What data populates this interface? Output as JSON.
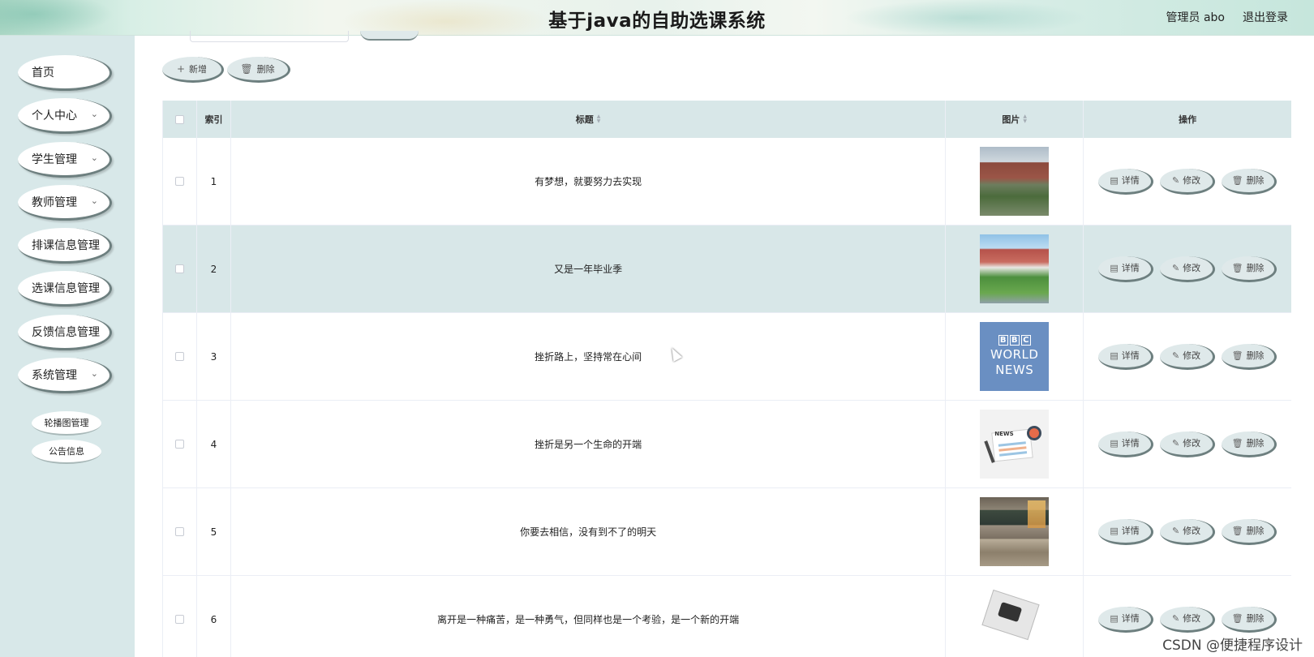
{
  "header": {
    "title": "基于java的自助选课系统",
    "user_label": "管理员 abo",
    "logout_label": "退出登录"
  },
  "sidebar": {
    "items": [
      {
        "label": "首页",
        "has_children": false
      },
      {
        "label": "个人中心",
        "has_children": true
      },
      {
        "label": "学生管理",
        "has_children": true
      },
      {
        "label": "教师管理",
        "has_children": true
      },
      {
        "label": "排课信息管理",
        "has_children": false
      },
      {
        "label": "选课信息管理",
        "has_children": false
      },
      {
        "label": "反馈信息管理",
        "has_children": false
      },
      {
        "label": "系统管理",
        "has_children": true
      }
    ],
    "sub_items": [
      "轮播图管理",
      "公告信息"
    ]
  },
  "toolbar": {
    "add_label": "新增",
    "delete_label": "删除"
  },
  "table": {
    "columns": [
      "索引",
      "标题",
      "图片",
      "操作"
    ],
    "rows": [
      {
        "index": "1",
        "title": "有梦想，就要努力去实现",
        "image": "campus-building"
      },
      {
        "index": "2",
        "title": "又是一年毕业季",
        "image": "campus-courtyard"
      },
      {
        "index": "3",
        "title": "挫折路上，坚持常在心间",
        "image": "bbc-world-news"
      },
      {
        "index": "4",
        "title": "挫折是另一个生命的开端",
        "image": "news-illustration"
      },
      {
        "index": "5",
        "title": "你要去相信，没有到不了的明天",
        "image": "classroom"
      },
      {
        "index": "6",
        "title": "离开是一种痛苦，是一种勇气，但同样也是一个考验，是一个新的开端",
        "image": "newspaper"
      }
    ],
    "actions": {
      "detail": "详情",
      "edit": "修改",
      "delete": "删除"
    }
  },
  "bbc_logo": {
    "letters": [
      "B",
      "B",
      "C"
    ],
    "line1": "WORLD",
    "line2": "NEWS"
  },
  "news_logo_text": "NEWS",
  "watermark": "CSDN @便捷程序设计",
  "colors": {
    "accent": "#d8e7e8",
    "sidebar_bg": "#d8e8e9",
    "button_shadow": "#6d7f7f"
  }
}
